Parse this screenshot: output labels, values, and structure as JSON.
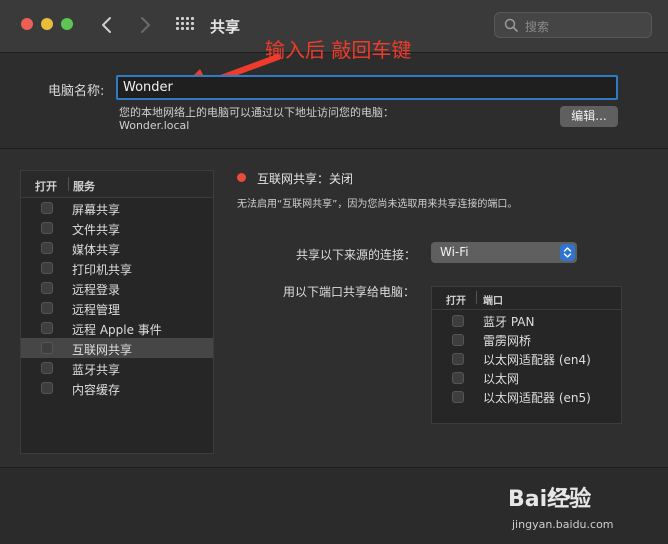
{
  "window": {
    "title": "共享",
    "search_placeholder": "搜索"
  },
  "annotation": {
    "text": "输入后 敲回车键",
    "color": "#ee3b2b"
  },
  "computer_name": {
    "label": "电脑名称:",
    "value": "Wonder",
    "description": "您的本地网络上的电脑可以通过以下地址访问您的电脑：",
    "address": "Wonder.local",
    "edit_button": "编辑..."
  },
  "services": {
    "header_open": "打开",
    "header_service": "服务",
    "items": [
      {
        "label": "屏幕共享",
        "checked": false
      },
      {
        "label": "文件共享",
        "checked": false
      },
      {
        "label": "媒体共享",
        "checked": false
      },
      {
        "label": "打印机共享",
        "checked": false
      },
      {
        "label": "远程登录",
        "checked": false
      },
      {
        "label": "远程管理",
        "checked": false
      },
      {
        "label": "远程 Apple 事件",
        "checked": false
      },
      {
        "label": "互联网共享",
        "checked": false,
        "selected": true
      },
      {
        "label": "蓝牙共享",
        "checked": false
      },
      {
        "label": "内容缓存",
        "checked": false
      }
    ]
  },
  "detail": {
    "status": "互联网共享：关闭",
    "status_color": "#ec4a3b",
    "description": "无法启用“互联网共享”，因为您尚未选取用来共享连接的端口。",
    "source_label": "共享以下来源的连接：",
    "source_value": "Wi-Fi",
    "to_label": "用以下端口共享给电脑：",
    "ports_header_open": "打开",
    "ports_header_port": "端口",
    "ports": [
      {
        "label": "蓝牙 PAN",
        "checked": false
      },
      {
        "label": "雷雳网桥",
        "checked": false
      },
      {
        "label": "以太网适配器 (en4)",
        "checked": false
      },
      {
        "label": "以太网",
        "checked": false
      },
      {
        "label": "以太网适配器 (en5)",
        "checked": false
      }
    ]
  },
  "watermark": {
    "brand": "Bai经验",
    "url": "jingyan.baidu.com"
  }
}
